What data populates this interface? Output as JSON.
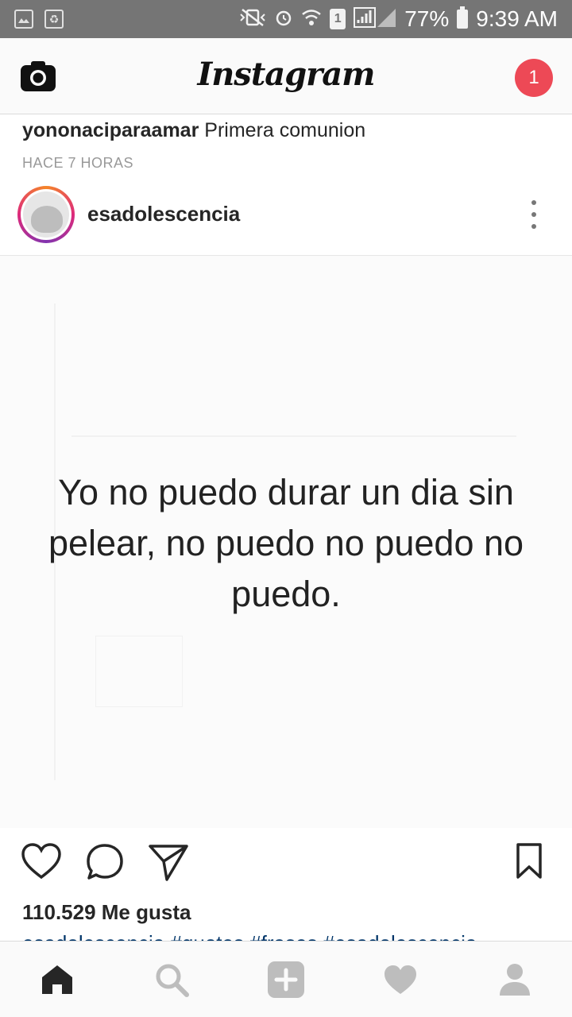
{
  "status_bar": {
    "icons": [
      "gallery-icon",
      "recycle-icon",
      "vibrate-icon",
      "alarm-icon",
      "wifi-icon",
      "sim-icon",
      "signal-icon",
      "battery-icon"
    ],
    "sim_number": "1",
    "battery": "77%",
    "time": "9:39 AM"
  },
  "header": {
    "title": "Instagram",
    "notification_count": "1"
  },
  "previous_post": {
    "username": "yononaciparaamar",
    "caption": "Primera comunion",
    "time": "HACE 7 HORAS"
  },
  "post": {
    "username": "esadolescencia",
    "image_text": "Yo no puedo durar un dia sin pelear, no puedo no puedo no puedo.",
    "likes": "110.529 Me gusta",
    "caption_preview": "esadolescencia #quotes #frases #esadolescencia"
  },
  "bottom_nav": [
    "home-icon",
    "search-icon",
    "add-icon",
    "heart-icon",
    "profile-icon"
  ],
  "colors": {
    "status_bar": "#757575",
    "badge": "#ed4956",
    "text": "#262626",
    "muted": "#999999",
    "hashtag": "#003569"
  }
}
